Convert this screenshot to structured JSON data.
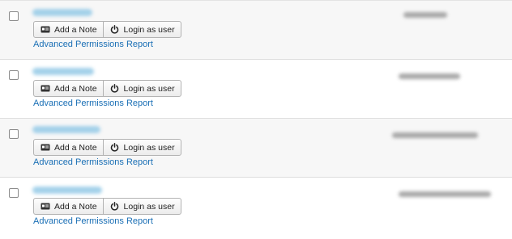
{
  "users": [
    {
      "add_note_label": "Add a Note",
      "login_label": "Login as user",
      "report_link": "Advanced Permissions Report"
    },
    {
      "add_note_label": "Add a Note",
      "login_label": "Login as user",
      "report_link": "Advanced Permissions Report"
    },
    {
      "add_note_label": "Add a Note",
      "login_label": "Login as user",
      "report_link": "Advanced Permissions Report"
    },
    {
      "add_note_label": "Add a Note",
      "login_label": "Login as user",
      "report_link": "Advanced Permissions Report"
    }
  ],
  "icons": {
    "add_note": "note-card-icon",
    "login": "power-icon"
  },
  "colors": {
    "link": "#1a6fb5",
    "blurred_name": "#9fcfe9",
    "row_alt_bg": "#f7f7f7"
  }
}
